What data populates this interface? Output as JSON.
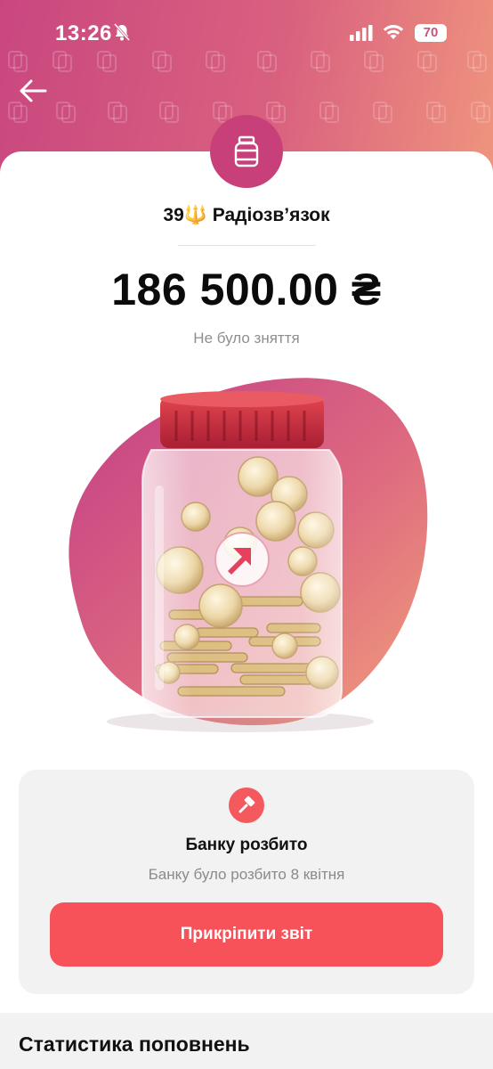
{
  "status_bar": {
    "time": "13:26",
    "battery": "70",
    "icons": [
      "bell-slash-icon",
      "cellular-signal-icon",
      "wifi-icon",
      "battery-icon"
    ]
  },
  "header": {
    "back_icon": "arrow-left-icon",
    "gradient_colors": [
      "#c9477f",
      "#f0967e"
    ]
  },
  "jar": {
    "icon": "jar-icon",
    "name": "39🔱 Радіозв’язок",
    "balance": "186 500.00 ₴",
    "withdrawal_note": "Не було зняття"
  },
  "status_panel": {
    "icon": "hammer-icon",
    "title": "Банку розбито",
    "subtitle": "Банку було розбито 8 квітня",
    "button_label": "Прикріпити звіт",
    "accent_color": "#f7525a"
  },
  "stats": {
    "title": "Статистика поповнень"
  }
}
